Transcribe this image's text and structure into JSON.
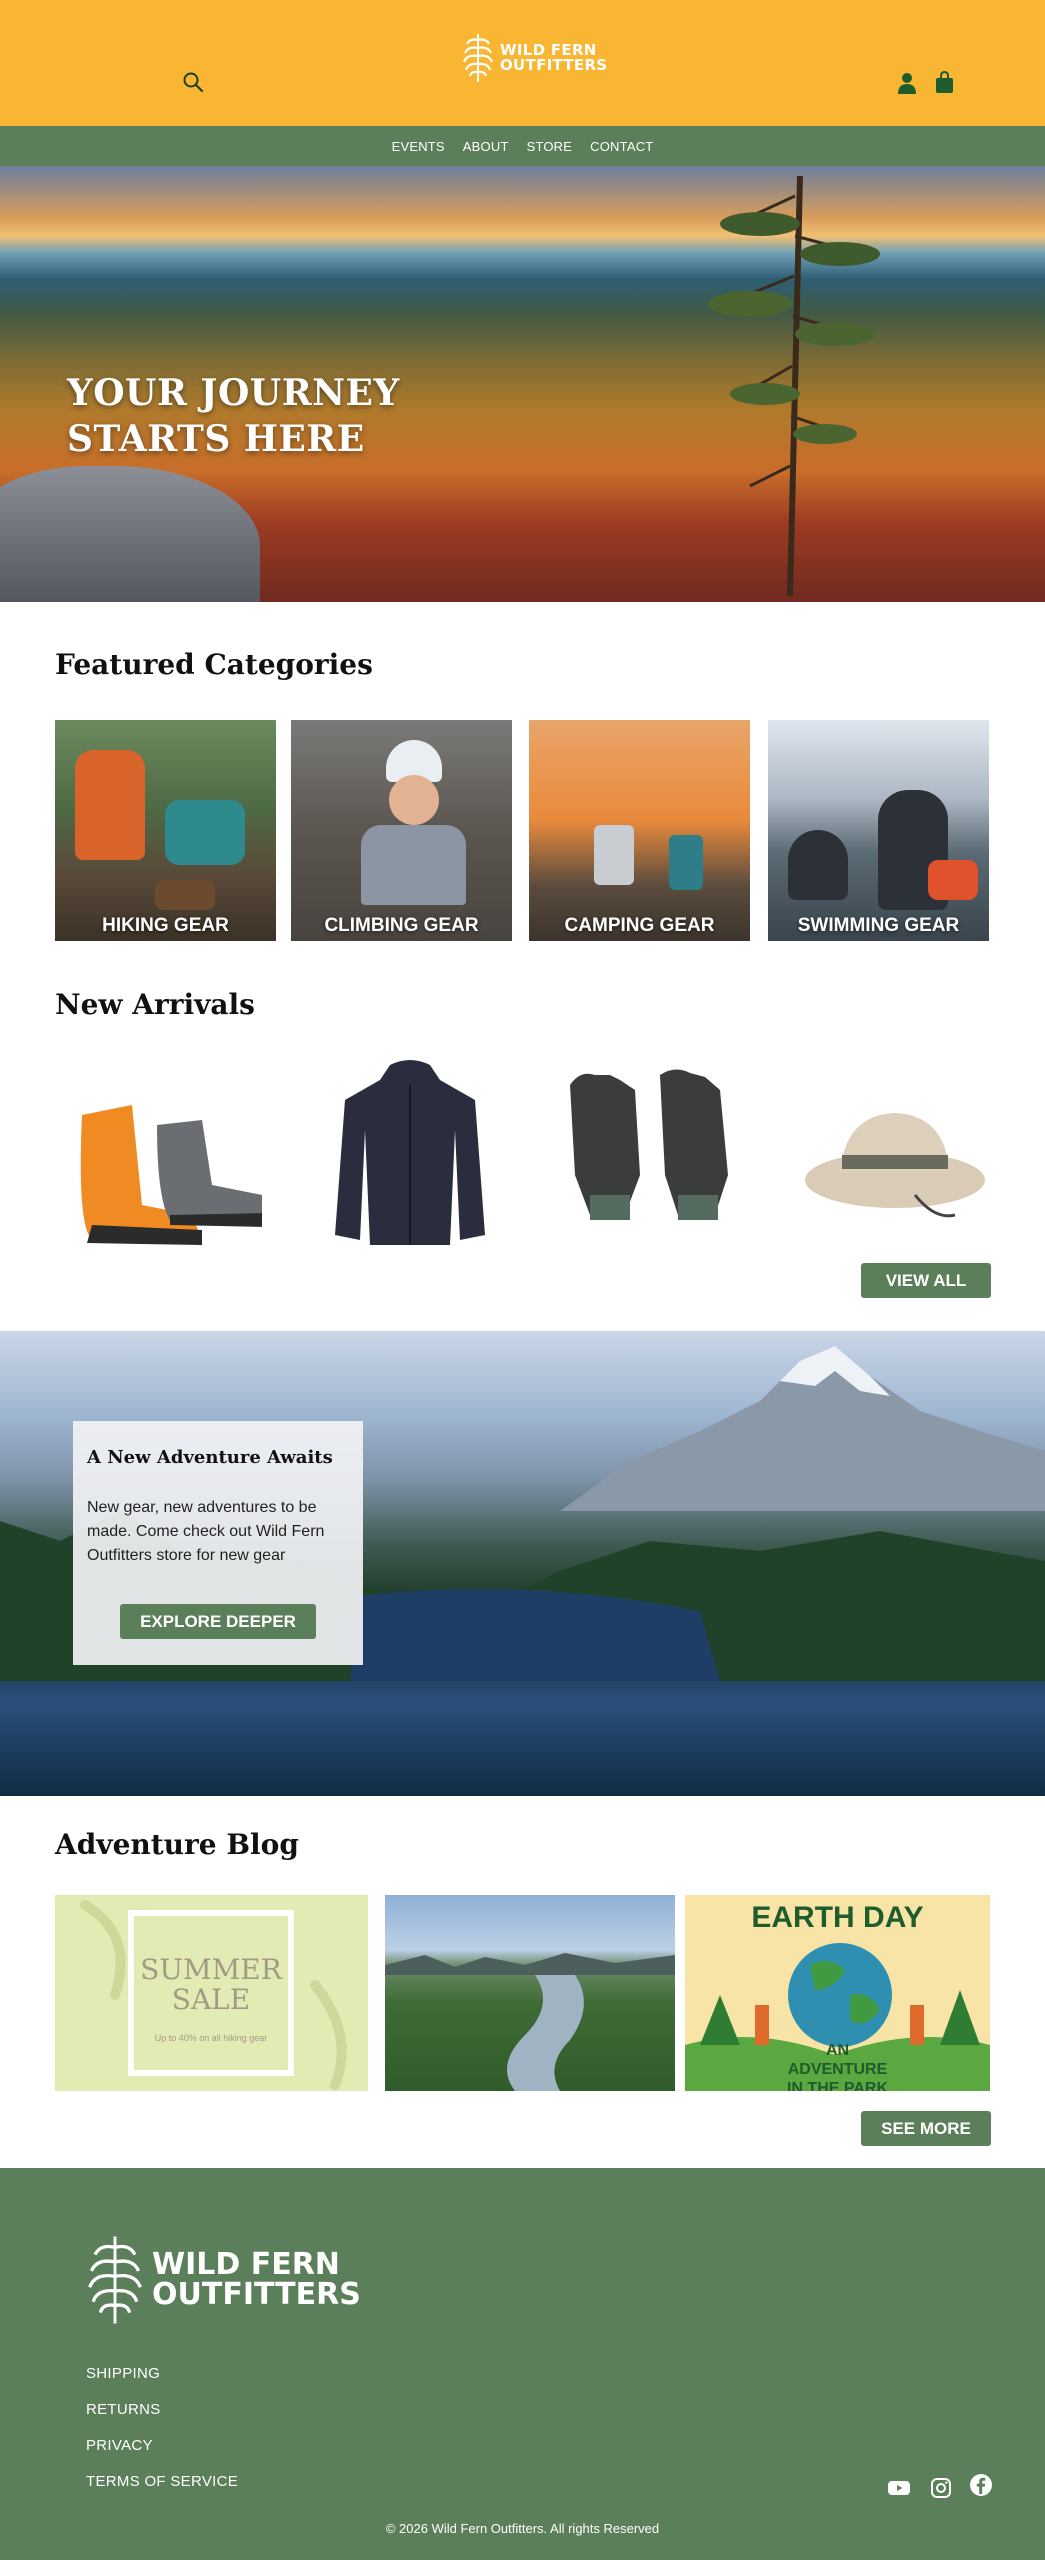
{
  "header": {
    "logo_text": "WILD FERN\nOUTFITTERS",
    "nav": [
      "EVENTS",
      "ABOUT",
      "STORE",
      "CONTACT"
    ]
  },
  "hero": {
    "title": "YOUR JOURNEY\nSTARTS HERE"
  },
  "featured": {
    "title": "Featured Categories",
    "categories": [
      "HIKING GEAR",
      "CLIMBING GEAR",
      "CAMPING GEAR",
      "SWIMMING GEAR"
    ]
  },
  "arrivals": {
    "title": "New Arrivals",
    "view_all": "VIEW ALL"
  },
  "banner": {
    "title": "A New Adventure Awaits",
    "body": "New gear, new adventures to be made. Come check out Wild Fern Outfitters store for new gear",
    "button": "EXPLORE DEEPER"
  },
  "blog": {
    "title": "Adventure Blog",
    "summer_title": "SUMMER\nSALE",
    "summer_sub": "Up to 40% on all hiking gear",
    "earth_title": "EARTH DAY",
    "earth_sub": "AN ADVENTURE\nIN THE PARK",
    "see_more": "SEE MORE"
  },
  "footer": {
    "logo_text": "WILD FERN\nOUTFITTERS",
    "links": [
      "SHIPPING",
      "RETURNS",
      "PRIVACY",
      "TERMS OF SERVICE"
    ],
    "copyright": "© 2026 Wild Fern Outfitters. All rights Reserved"
  },
  "colors": {
    "header": "#F8B633",
    "brand_green": "#5B7F5A",
    "icon_green": "#1f5c2c"
  },
  "icons": [
    "search-icon",
    "fern-logo-icon",
    "user-icon",
    "shopping-bag-icon",
    "youtube-icon",
    "instagram-icon",
    "facebook-icon"
  ]
}
